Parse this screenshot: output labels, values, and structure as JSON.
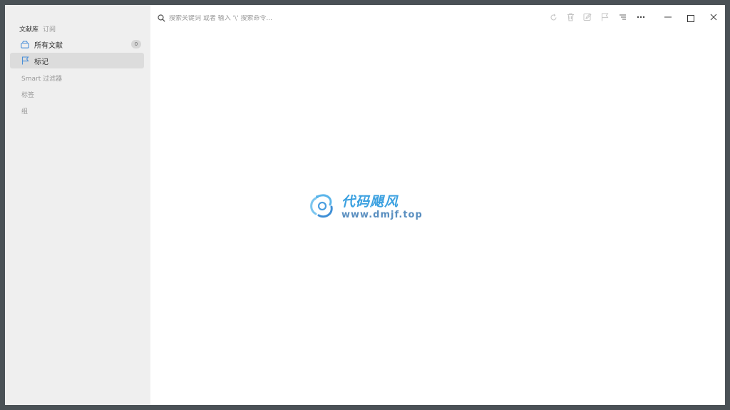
{
  "sidebar": {
    "library_label": "文献库",
    "subscribe_label": "订阅",
    "items": [
      {
        "label": "所有文献",
        "count": "0",
        "icon": "tray-icon"
      },
      {
        "label": "标记",
        "icon": "flag-icon"
      }
    ],
    "sections": [
      "Smart 过滤器",
      "标签",
      "组"
    ]
  },
  "toolbar": {
    "search_placeholder": "搜索关键词 或者 输入 '\\' 搜索命令...",
    "icons": [
      "refresh-icon",
      "trash-icon",
      "edit-icon",
      "flag-icon",
      "sort-icon",
      "more-icon"
    ],
    "window_controls": [
      "minimize-icon",
      "maximize-icon",
      "close-icon"
    ]
  },
  "watermark": {
    "title": "代码飓风",
    "url": "www.dmjf.top"
  },
  "colors": {
    "accent": "#4a8fd8",
    "sidebar_bg": "#efefef",
    "frame": "#4a5156"
  }
}
